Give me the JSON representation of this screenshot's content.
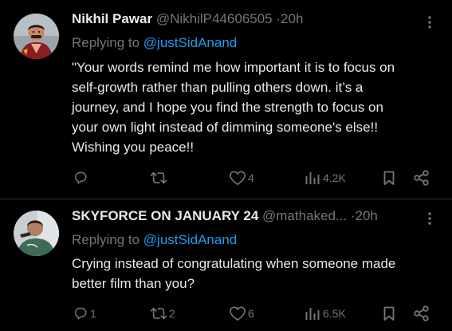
{
  "tweets": [
    {
      "author_name": "Nikhil Pawar",
      "author_handle": "@NikhilP44606505",
      "separator": "·",
      "time": "20h",
      "replying_prefix": "Replying to",
      "replying_to": "@justSidAnand",
      "body_lines": [
        "\"Your words remind me how important it is to focus on",
        "self-growth rather than pulling others down. it’s a",
        "journey, and I hope you find the strength to focus on",
        "your own light instead of dimming someone's else!!",
        "Wishing you peace!!"
      ],
      "reply_count": "",
      "repost_count": "",
      "like_count": "4",
      "view_count": "4.2K"
    },
    {
      "author_name": "SKYFORCE ON JANUARY 24",
      "author_handle": "@mathaked...",
      "separator": "·",
      "time": "20h",
      "replying_prefix": "Replying to",
      "replying_to": "@justSidAnand",
      "body_lines": [
        "Crying instead of congratulating when someone made",
        "better film than you?"
      ],
      "reply_count": "1",
      "repost_count": "2",
      "like_count": "6",
      "view_count": "6.5K"
    }
  ],
  "icons": {
    "reply": "reply-icon",
    "repost": "repost-icon",
    "like": "heart-icon",
    "views": "views-icon",
    "bookmark": "bookmark-icon",
    "share": "share-icon",
    "more": "more-options-icon"
  },
  "colors": {
    "background": "#000000",
    "text": "#e7e9ea",
    "muted": "#71767b",
    "link": "#1d9bf0",
    "divider": "#2f3336"
  }
}
